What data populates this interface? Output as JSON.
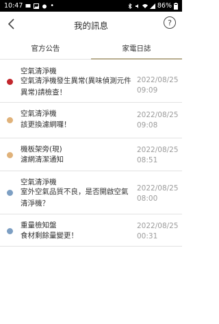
{
  "status_bar": {
    "time": "10:47",
    "battery": "86%"
  },
  "header": {
    "title": "我的訊息",
    "help_label": "?"
  },
  "tabs": [
    {
      "label": "官方公告"
    },
    {
      "label": "家電日誌"
    }
  ],
  "messages": [
    {
      "device": "空氣清淨機",
      "message": "空氣清淨機發生異常(異味偵測元件異常)請檢查！",
      "date": "2022/08/25",
      "time": "09:09",
      "dot_color": "#c2272d"
    },
    {
      "device": "空氣清淨機",
      "message": "該更換濾網囉！",
      "date": "2022/08/25",
      "time": "09:08",
      "dot_color": "#e0b27a"
    },
    {
      "device": "機板架旁(現)",
      "message": "濾網清潔通知",
      "date": "2022/08/25",
      "time": "08:51",
      "dot_color": "#e0b27a"
    },
    {
      "device": "空氣清淨機",
      "message": "室外空氣品質不良，是否開啟空氣清淨機？",
      "date": "2022/08/25",
      "time": "08:00",
      "dot_color": "#7d9fc3"
    },
    {
      "device": "重量檢知盤",
      "message": "食材剩餘量變更！",
      "date": "2022/08/25",
      "time": "00:31",
      "dot_color": "#7d9fc3"
    }
  ]
}
